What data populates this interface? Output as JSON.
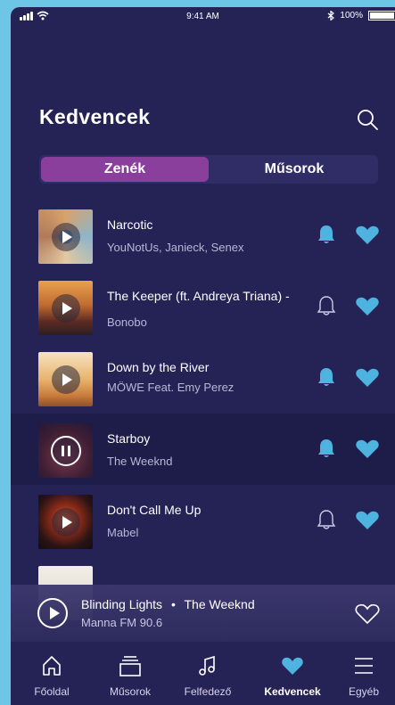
{
  "status_bar": {
    "time": "9:41 AM",
    "battery": "100%"
  },
  "header": {
    "title": "Kedvencek"
  },
  "segments": {
    "active": "Zenék",
    "inactive": "Műsorok"
  },
  "tracks": [
    {
      "title": "Narcotic",
      "artist": "YouNotUs, Janieck, Senex",
      "notify": true,
      "favorite": true,
      "state": "paused",
      "cover": "#c9a27a"
    },
    {
      "title": "The Keeper (ft. Andreya Triana) -",
      "artist": "Bonobo",
      "notify": false,
      "favorite": true,
      "state": "paused",
      "cover": "#a6542c"
    },
    {
      "title": "Down by the River",
      "artist": "MÖWE Feat. Emy Perez",
      "notify": true,
      "favorite": true,
      "state": "paused",
      "cover": "#e2b67a"
    },
    {
      "title": "Starboy",
      "artist": "The Weeknd",
      "notify": true,
      "favorite": true,
      "state": "playing",
      "cover": "#5a2a3a"
    },
    {
      "title": "Don't Call Me Up",
      "artist": "Mabel",
      "notify": false,
      "favorite": true,
      "state": "paused",
      "cover": "#3a1a18"
    }
  ],
  "now_playing": {
    "title": "Blinding Lights",
    "separator": "•",
    "artist": "The Weeknd",
    "station": "Manna FM 90.6"
  },
  "tabbar": {
    "items": [
      {
        "label": "Főoldal",
        "icon": "home-icon"
      },
      {
        "label": "Műsorok",
        "icon": "shows-icon"
      },
      {
        "label": "Felfedező",
        "icon": "music-note-icon"
      },
      {
        "label": "Kedvencek",
        "icon": "heart-icon",
        "active": true
      },
      {
        "label": "Egyéb",
        "icon": "menu-icon"
      }
    ]
  },
  "colors": {
    "background": "#252356",
    "accent": "#4fb3e0",
    "segment_active": "#8b3f9c",
    "frame": "#6ec6e6"
  }
}
